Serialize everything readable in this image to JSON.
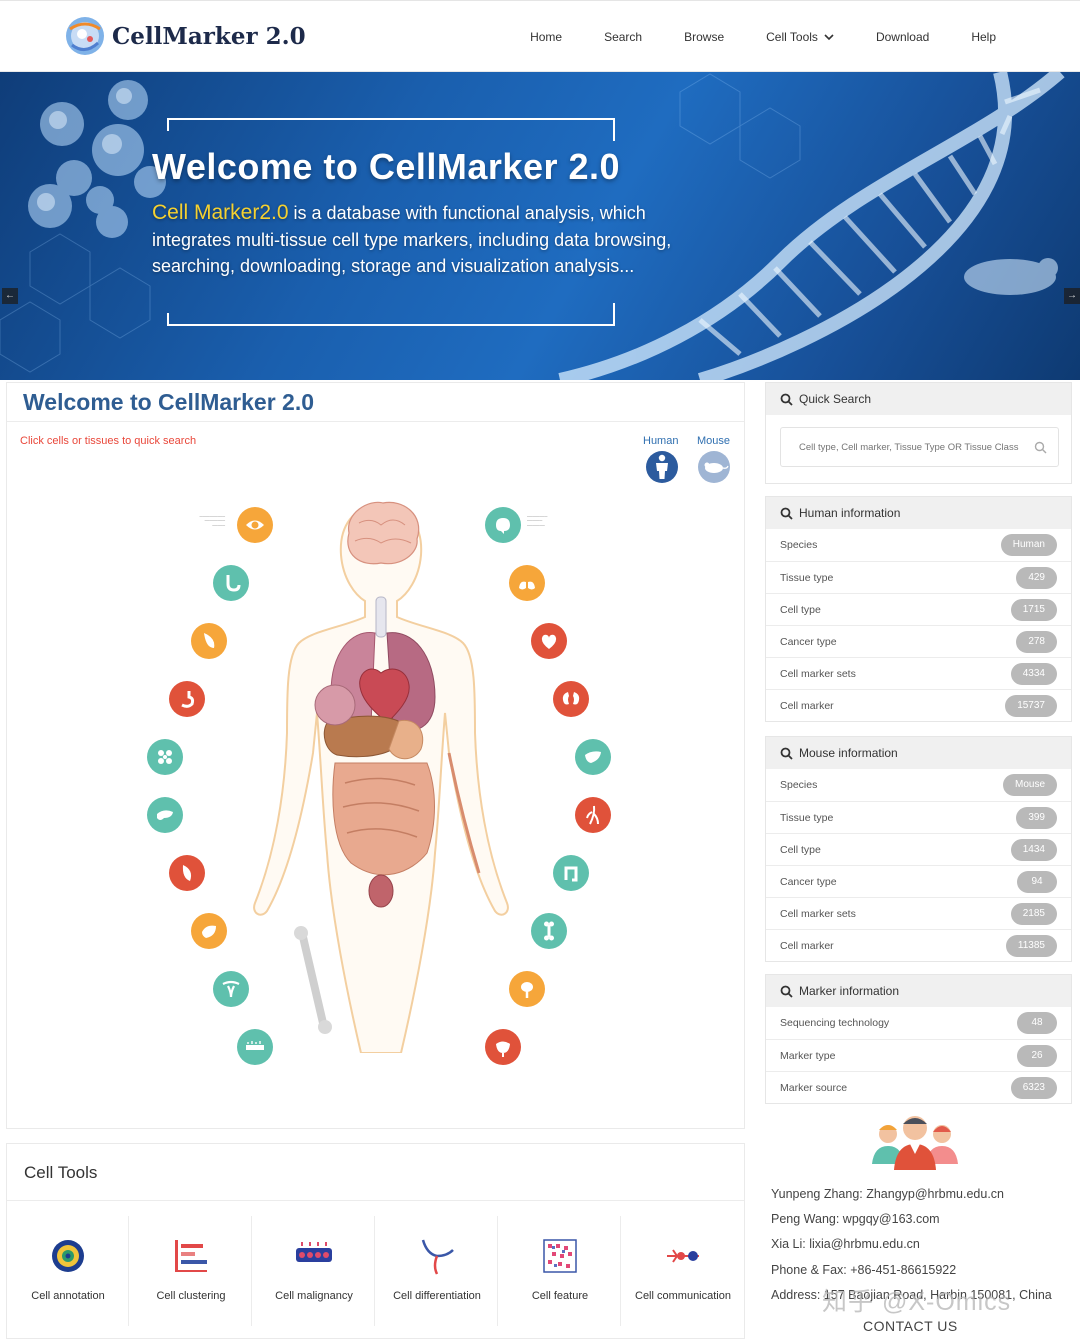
{
  "nav": {
    "brand": "CellMarker 2.0",
    "items": [
      {
        "label": "Home"
      },
      {
        "label": "Search"
      },
      {
        "label": "Browse"
      },
      {
        "label": "Cell Tools"
      },
      {
        "label": "Download"
      },
      {
        "label": "Help"
      }
    ]
  },
  "banner": {
    "title": "Welcome to CellMarker 2.0",
    "highlight": "Cell Marker2.0",
    "text": " is a database with functional analysis, which integrates multi-tissue cell type markers, including data browsing, searching, downloading, storage and visualization analysis...",
    "prev_arrow": "←",
    "next_arrow": "→"
  },
  "main": {
    "title": "Welcome to CellMarker 2.0",
    "hint": "Click cells or tissues to quick search",
    "species_human": "Human",
    "species_mouse": "Mouse"
  },
  "quick_search": {
    "heading": "Quick Search",
    "placeholder": "Cell type, Cell marker, Tissue Type OR Tissue Class"
  },
  "human_info": {
    "heading": "Human information",
    "rows": [
      {
        "label": "Species",
        "value": "Human"
      },
      {
        "label": "Tissue type",
        "value": "429"
      },
      {
        "label": "Cell type",
        "value": "1715"
      },
      {
        "label": "Cancer type",
        "value": "278"
      },
      {
        "label": "Cell marker sets",
        "value": "4334"
      },
      {
        "label": "Cell marker",
        "value": "15737"
      }
    ]
  },
  "mouse_info": {
    "heading": "Mouse information",
    "rows": [
      {
        "label": "Species",
        "value": "Mouse"
      },
      {
        "label": "Tissue type",
        "value": "399"
      },
      {
        "label": "Cell type",
        "value": "1434"
      },
      {
        "label": "Cancer type",
        "value": "94"
      },
      {
        "label": "Cell marker sets",
        "value": "2185"
      },
      {
        "label": "Cell marker",
        "value": "11385"
      }
    ]
  },
  "marker_info": {
    "heading": "Marker information",
    "rows": [
      {
        "label": "Sequencing technology",
        "value": "48"
      },
      {
        "label": "Marker type",
        "value": "26"
      },
      {
        "label": "Marker source",
        "value": "6323"
      }
    ]
  },
  "tools": {
    "heading": "Cell Tools",
    "items": [
      {
        "label": "Cell annotation"
      },
      {
        "label": "Cell clustering"
      },
      {
        "label": "Cell malignancy"
      },
      {
        "label": "Cell differentiation"
      },
      {
        "label": "Cell feature"
      },
      {
        "label": "Cell communication"
      }
    ]
  },
  "contact": {
    "lines": [
      "Yunpeng Zhang: Zhangyp@hrbmu.edu.cn",
      "Peng Wang: wpgqy@163.com",
      "Xia Li: lixia@hrbmu.edu.cn",
      "Phone & Fax: +86-451-86615922",
      "Address: 157 Baojian Road, Harbin 150081, China"
    ],
    "heading": "CONTACT US"
  },
  "watermark": "知乎 @X-Omics",
  "colors": {
    "title_blue": "#2f5d92",
    "hint_red": "#e9473a",
    "teal": "#5fc0ad",
    "orange": "#f6a63a",
    "red": "#e0523a",
    "badge_gray": "#b9b9b9"
  }
}
